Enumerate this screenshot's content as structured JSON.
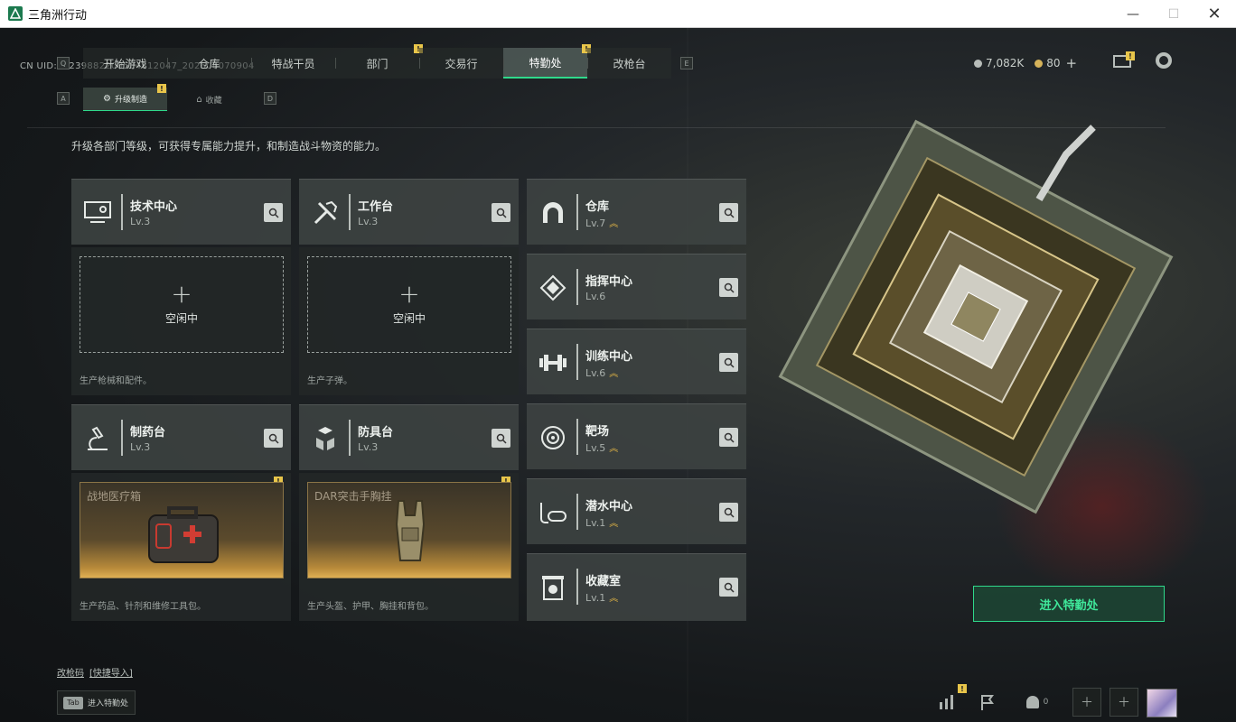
{
  "window": {
    "title": "三角洲行动",
    "min_glyph": "—",
    "max_glyph": "☐",
    "close_glyph": "✕"
  },
  "uid": "CN UID:8123988220950481204​7_202606070904",
  "keyhints": {
    "prev": "Q",
    "next": "E",
    "sub_prev": "A",
    "sub_next": "D"
  },
  "nav": {
    "tabs": [
      {
        "label": "开始游戏",
        "badge": ""
      },
      {
        "label": "仓库",
        "badge": ""
      },
      {
        "label": "特战干员",
        "badge": ""
      },
      {
        "label": "部门",
        "badge": "!"
      },
      {
        "label": "交易行",
        "badge": ""
      },
      {
        "label": "特勤处",
        "badge": "!",
        "active": true
      },
      {
        "label": "改枪台",
        "badge": ""
      }
    ]
  },
  "subnav": {
    "tabs": [
      {
        "label": "升级制造",
        "icon": "⚙",
        "badge": "!",
        "active": true
      },
      {
        "label": "收藏",
        "icon": "⌂",
        "badge": ""
      }
    ]
  },
  "currency": {
    "a_value": "7,082K",
    "b_value": "80",
    "add": "+"
  },
  "mail_badge": "!",
  "description": "升级各部门等级，可获得专属能力提升，和制造战斗物资的能力。",
  "facilities": {
    "tech_center": {
      "name": "技术中心",
      "lv": "Lv.3",
      "icon": "monitor-icon"
    },
    "workbench": {
      "name": "工作台",
      "lv": "Lv.3",
      "icon": "tools-icon"
    },
    "pharmacy": {
      "name": "制药台",
      "lv": "Lv.3",
      "icon": "microscope-icon"
    },
    "armory": {
      "name": "防具台",
      "lv": "Lv.3",
      "icon": "cubes-icon"
    },
    "warehouse": {
      "name": "仓库",
      "lv": "Lv.7",
      "upgradable": true,
      "icon": "arch-icon"
    },
    "command": {
      "name": "指挥中心",
      "lv": "Lv.6",
      "upgradable": false,
      "icon": "chip-icon"
    },
    "training": {
      "name": "训练中心",
      "lv": "Lv.6",
      "upgradable": true,
      "icon": "dumbbell-icon"
    },
    "range": {
      "name": "靶场",
      "lv": "Lv.5",
      "upgradable": true,
      "icon": "target-icon"
    },
    "diving": {
      "name": "潜水中心",
      "lv": "Lv.1",
      "upgradable": true,
      "icon": "snorkel-icon"
    },
    "collection": {
      "name": "收藏室",
      "lv": "Lv.1",
      "upgradable": true,
      "icon": "display-case-icon"
    }
  },
  "production": {
    "tech": {
      "status": "空闲中",
      "note": "生产枪械和配件。"
    },
    "workbench": {
      "status": "空闲中",
      "note": "生产子弹。"
    },
    "pharmacy": {
      "item": "战地医疗箱",
      "note": "生产药品、针剂和维修工具包。",
      "badge": "!"
    },
    "armory": {
      "item": "DAR突击手胸挂",
      "note": "生产头盔、护甲、胸挂和背包。",
      "badge": "!"
    }
  },
  "enter_button": "进入特勤处",
  "links": {
    "a": "改枪码",
    "b": "[快捷导入]"
  },
  "tab_hint": {
    "key": "Tab",
    "label": "进入特勤处"
  },
  "bottom": {
    "stats_badge": "!",
    "friends_count": "0"
  },
  "colors": {
    "accent": "#2fd98b",
    "badge": "#e8c54a",
    "upgrade": "#e3b646"
  }
}
